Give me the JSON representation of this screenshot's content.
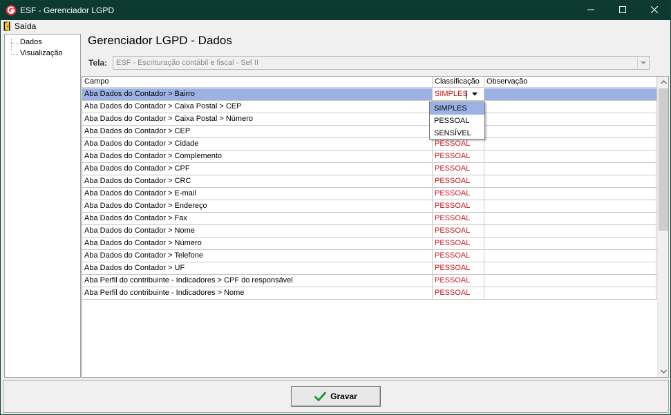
{
  "window": {
    "title": "ESF - Gerenciador LGPD",
    "title_color": "#0c3a31",
    "controls": [
      "minimize-icon",
      "maximize-icon",
      "close-icon"
    ]
  },
  "menu": {
    "items": [
      {
        "label": "Saída",
        "icon": "exit-door-icon"
      }
    ]
  },
  "tree": {
    "items": [
      {
        "label": "Dados"
      },
      {
        "label": "Visualização"
      }
    ]
  },
  "page": {
    "heading": "Gerenciador LGPD - Dados",
    "tela_label": "Tela:",
    "tela_value": "ESF - Escrituração contábil e fiscal - Sef II"
  },
  "grid": {
    "columns": [
      "Campo",
      "Classificação",
      "Observação"
    ],
    "selected_row": 0,
    "classification_color": "#c8141e",
    "selection_color": "#9db2e4",
    "rows": [
      {
        "campo": "Aba Dados do Contador > Bairro",
        "classificacao": "SIMPLES",
        "observacao": ""
      },
      {
        "campo": "Aba Dados do Contador > Caixa Postal > CEP",
        "classificacao": "",
        "observacao": ""
      },
      {
        "campo": "Aba Dados do Contador > Caixa Postal > Número",
        "classificacao": "",
        "observacao": ""
      },
      {
        "campo": "Aba Dados do Contador > CEP",
        "classificacao": "",
        "observacao": ""
      },
      {
        "campo": "Aba Dados do Contador > Cidade",
        "classificacao": "PESSOAL",
        "observacao": ""
      },
      {
        "campo": "Aba Dados do Contador > Complemento",
        "classificacao": "PESSOAL",
        "observacao": ""
      },
      {
        "campo": "Aba Dados do Contador > CPF",
        "classificacao": "PESSOAL",
        "observacao": ""
      },
      {
        "campo": "Aba Dados do Contador > CRC",
        "classificacao": "PESSOAL",
        "observacao": ""
      },
      {
        "campo": "Aba Dados do Contador > E-mail",
        "classificacao": "PESSOAL",
        "observacao": ""
      },
      {
        "campo": "Aba Dados do Contador > Endereço",
        "classificacao": "PESSOAL",
        "observacao": ""
      },
      {
        "campo": "Aba Dados do Contador > Fax",
        "classificacao": "PESSOAL",
        "observacao": ""
      },
      {
        "campo": "Aba Dados do Contador > Nome",
        "classificacao": "PESSOAL",
        "observacao": ""
      },
      {
        "campo": "Aba Dados do Contador > Número",
        "classificacao": "PESSOAL",
        "observacao": ""
      },
      {
        "campo": "Aba Dados do Contador > Telefone",
        "classificacao": "PESSOAL",
        "observacao": ""
      },
      {
        "campo": "Aba Dados do Contador > UF",
        "classificacao": "PESSOAL",
        "observacao": ""
      },
      {
        "campo": "Aba Perfil do contribuinte - Indicadores > CPF do responsável",
        "classificacao": "PESSOAL",
        "observacao": ""
      },
      {
        "campo": "Aba Perfil do contribuinte - Indicadores > Nome",
        "classificacao": "PESSOAL",
        "observacao": ""
      }
    ],
    "dropdown": {
      "options": [
        "SIMPLES",
        "PESSOAL",
        "SENSÍVEL"
      ],
      "highlighted": 0
    }
  },
  "footer": {
    "save_label": "Gravar",
    "save_icon": "green-check-icon"
  }
}
